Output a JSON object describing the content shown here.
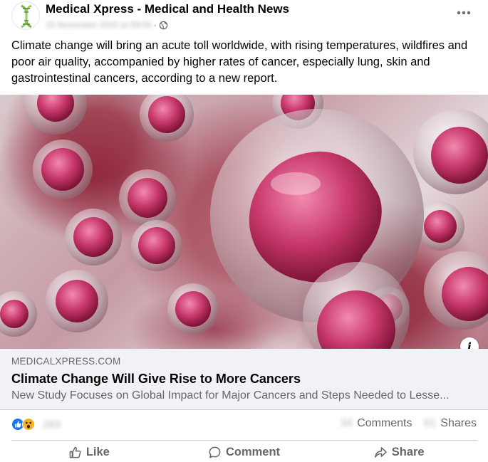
{
  "post": {
    "page_name": "Medical Xpress - Medical and Health News",
    "timestamp": "15 November 2020 at 09:00",
    "separator": "·",
    "caption": "Climate change will bring an acute toll worldwide, with rising temperatures, wildfires and poor air quality, accompanied by higher rates of cancer, especially lung, skin and gastrointestinal cancers, according to a new report.",
    "icons": {
      "avatar": "dna-logo-icon",
      "privacy": "globe-icon",
      "more": "more-options-icon",
      "info": "info-icon"
    }
  },
  "link": {
    "domain": "MEDICALXPRESS.COM",
    "title": "Climate Change Will Give Rise to More Cancers",
    "description": "New Study Focuses on Global Impact for Major Cancers and Steps Needed to Lesse...",
    "info_label": "i"
  },
  "engagement": {
    "reaction_count": "263",
    "comments_count": "34",
    "comments_label": "Comments",
    "shares_count": "91",
    "shares_label": "Shares"
  },
  "actions": {
    "like": "Like",
    "comment": "Comment",
    "share": "Share"
  },
  "colors": {
    "like_blue": "#1877f2",
    "wow_yellow": "#f7b125",
    "secondary_text": "#65676b",
    "preview_bg": "#f0f2f5"
  }
}
